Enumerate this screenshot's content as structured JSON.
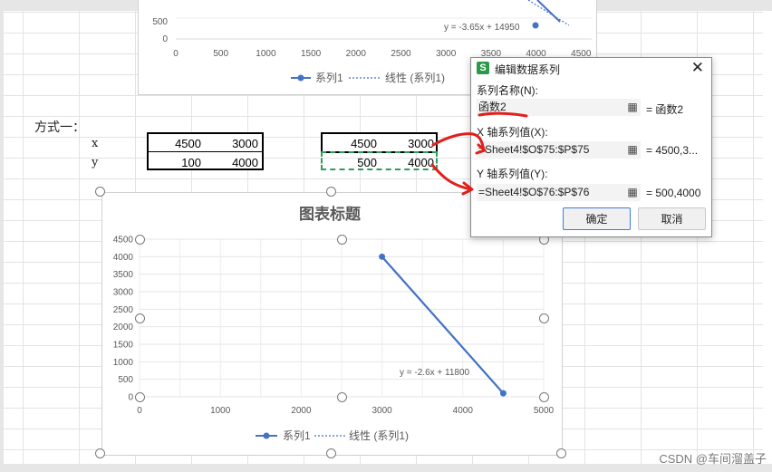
{
  "worksheet": {
    "method_label": "方式一：",
    "row_x_label": "x",
    "row_y_label": "y",
    "table_left": {
      "x_values": [
        "4500",
        "3000"
      ],
      "y_values": [
        "100",
        "4000"
      ]
    },
    "table_right": {
      "x_values": [
        "4500",
        "3000"
      ],
      "y_values": [
        "500",
        "4000"
      ]
    }
  },
  "top_chart": {
    "y_ticks": [
      "500",
      "0"
    ],
    "x_ticks": [
      "0",
      "500",
      "1000",
      "1500",
      "2000",
      "2500",
      "3000",
      "3500",
      "4000",
      "4500"
    ],
    "trendline_label": "y = -3.65x + 14950",
    "legend_series": "系列1",
    "legend_trend": "线性 (系列1)",
    "series_color": "#4472c4"
  },
  "main_chart": {
    "title": "图表标题",
    "y_ticks": [
      "4500",
      "4000",
      "3500",
      "3000",
      "2500",
      "2000",
      "1500",
      "1000",
      "500",
      "0"
    ],
    "x_ticks": [
      "0",
      "1000",
      "2000",
      "3000",
      "4000",
      "5000"
    ],
    "trendline_label": "y = -2.6x + 11800",
    "legend_series": "系列1",
    "legend_trend": "线性 (系列1)",
    "series_color": "#4472c4"
  },
  "dialog": {
    "title": "编辑数据系列",
    "app_icon": "S",
    "series_name_label": "系列名称(N):",
    "series_name_value": "函数2",
    "series_name_preview": "= 函数2",
    "x_label": "X 轴系列值(X):",
    "x_value": "=Sheet4!$O$75:$P$75",
    "x_preview": "= 4500,3...",
    "y_label": "Y 轴系列值(Y):",
    "y_value": "=Sheet4!$O$76:$P$76",
    "y_preview": "= 500,4000",
    "ok_label": "确定",
    "cancel_label": "取消",
    "annotation_color": "#e0201b"
  },
  "chart_data": [
    {
      "type": "scatter",
      "title": "图表标题",
      "xlabel": "",
      "ylabel": "",
      "xlim": [
        0,
        5000
      ],
      "ylim": [
        0,
        4500
      ],
      "grid": true,
      "legend": "bottom",
      "series": [
        {
          "name": "系列1",
          "x": [
            4500,
            3000
          ],
          "y": [
            100,
            4000
          ],
          "trendline": "y = -2.6x + 11800"
        }
      ]
    }
  ],
  "watermark": "CSDN @车间溜盖子"
}
